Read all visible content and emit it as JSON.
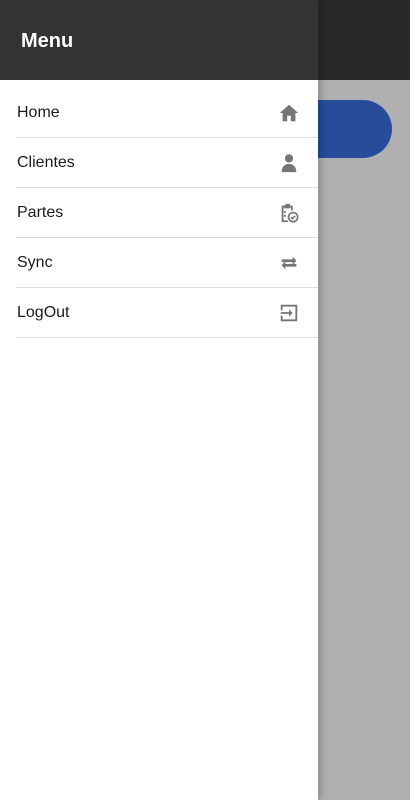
{
  "drawer": {
    "title": "Menu",
    "items": [
      {
        "label": "Home",
        "icon": "home-icon"
      },
      {
        "label": "Clientes",
        "icon": "person-icon"
      },
      {
        "label": "Partes",
        "icon": "clipboard-check-icon"
      },
      {
        "label": "Sync",
        "icon": "sync-arrows-icon"
      },
      {
        "label": "LogOut",
        "icon": "logout-icon"
      }
    ]
  },
  "colors": {
    "header_bg": "#333333",
    "accent_button": "#3a6fe0",
    "icon": "#757575",
    "divider": "#dddddd"
  }
}
